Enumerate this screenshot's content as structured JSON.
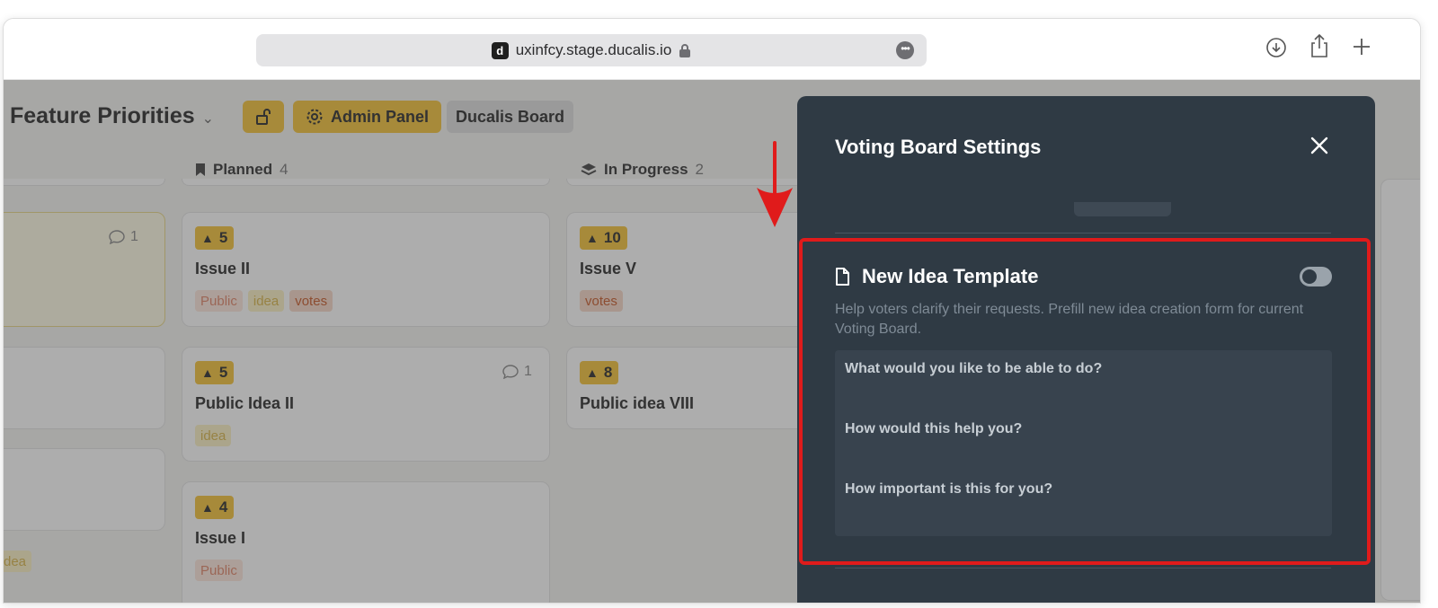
{
  "browser": {
    "url": "uxinfcy.stage.ducalis.io",
    "favicon_letter": "d",
    "icons": [
      "lock-icon",
      "more-icon",
      "download-icon",
      "share-icon",
      "new-tab-icon"
    ]
  },
  "board": {
    "title": "Feature Priorities",
    "admin_label": "Admin Panel",
    "board_label": "Ducalis Board"
  },
  "columns": [
    {
      "name": "Planned",
      "count": "4"
    },
    {
      "name": "In Progress",
      "count": "2"
    }
  ],
  "cards": {
    "left_comment": "1",
    "left_tag": "dea",
    "planned": [
      {
        "votes": "5",
        "title": "Issue II",
        "tags": [
          "Public",
          "idea",
          "votes"
        ],
        "comments": ""
      },
      {
        "votes": "5",
        "title": "Public Idea II",
        "tags": [
          "idea"
        ],
        "comments": "1"
      },
      {
        "votes": "4",
        "title": "Issue I",
        "tags": [
          "Public"
        ],
        "comments": ""
      }
    ],
    "in_progress": [
      {
        "votes": "10",
        "title": "Issue V",
        "tags": [
          "votes"
        ]
      },
      {
        "votes": "8",
        "title": "Public idea VIII",
        "tags": []
      }
    ]
  },
  "modal": {
    "title": "Voting Board Settings",
    "section_title": "New Idea Template",
    "toggle_on": false,
    "description": "Help voters clarify their requests. Prefill new idea creation form for current Voting Board.",
    "template_lines": [
      "What would you like to be able to do?",
      "How would this help you?",
      "How important is this for you?"
    ]
  },
  "colors": {
    "accent_yellow": "#f5c33a",
    "modal_bg": "#2f3a44",
    "highlight_red": "#e01b1b"
  }
}
